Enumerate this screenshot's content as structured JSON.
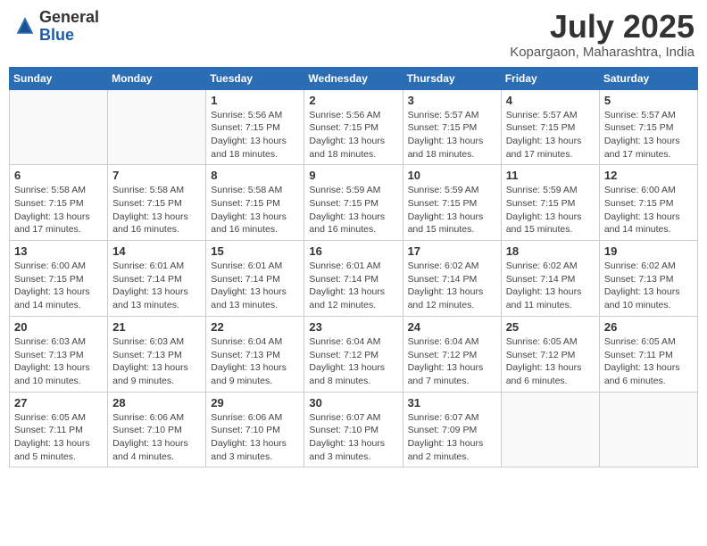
{
  "header": {
    "logo_general": "General",
    "logo_blue": "Blue",
    "title": "July 2025",
    "subtitle": "Kopargaon, Maharashtra, India"
  },
  "days_of_week": [
    "Sunday",
    "Monday",
    "Tuesday",
    "Wednesday",
    "Thursday",
    "Friday",
    "Saturday"
  ],
  "weeks": [
    [
      {
        "day": "",
        "info": ""
      },
      {
        "day": "",
        "info": ""
      },
      {
        "day": "1",
        "info": "Sunrise: 5:56 AM\nSunset: 7:15 PM\nDaylight: 13 hours and 18 minutes."
      },
      {
        "day": "2",
        "info": "Sunrise: 5:56 AM\nSunset: 7:15 PM\nDaylight: 13 hours and 18 minutes."
      },
      {
        "day": "3",
        "info": "Sunrise: 5:57 AM\nSunset: 7:15 PM\nDaylight: 13 hours and 18 minutes."
      },
      {
        "day": "4",
        "info": "Sunrise: 5:57 AM\nSunset: 7:15 PM\nDaylight: 13 hours and 17 minutes."
      },
      {
        "day": "5",
        "info": "Sunrise: 5:57 AM\nSunset: 7:15 PM\nDaylight: 13 hours and 17 minutes."
      }
    ],
    [
      {
        "day": "6",
        "info": "Sunrise: 5:58 AM\nSunset: 7:15 PM\nDaylight: 13 hours and 17 minutes."
      },
      {
        "day": "7",
        "info": "Sunrise: 5:58 AM\nSunset: 7:15 PM\nDaylight: 13 hours and 16 minutes."
      },
      {
        "day": "8",
        "info": "Sunrise: 5:58 AM\nSunset: 7:15 PM\nDaylight: 13 hours and 16 minutes."
      },
      {
        "day": "9",
        "info": "Sunrise: 5:59 AM\nSunset: 7:15 PM\nDaylight: 13 hours and 16 minutes."
      },
      {
        "day": "10",
        "info": "Sunrise: 5:59 AM\nSunset: 7:15 PM\nDaylight: 13 hours and 15 minutes."
      },
      {
        "day": "11",
        "info": "Sunrise: 5:59 AM\nSunset: 7:15 PM\nDaylight: 13 hours and 15 minutes."
      },
      {
        "day": "12",
        "info": "Sunrise: 6:00 AM\nSunset: 7:15 PM\nDaylight: 13 hours and 14 minutes."
      }
    ],
    [
      {
        "day": "13",
        "info": "Sunrise: 6:00 AM\nSunset: 7:15 PM\nDaylight: 13 hours and 14 minutes."
      },
      {
        "day": "14",
        "info": "Sunrise: 6:01 AM\nSunset: 7:14 PM\nDaylight: 13 hours and 13 minutes."
      },
      {
        "day": "15",
        "info": "Sunrise: 6:01 AM\nSunset: 7:14 PM\nDaylight: 13 hours and 13 minutes."
      },
      {
        "day": "16",
        "info": "Sunrise: 6:01 AM\nSunset: 7:14 PM\nDaylight: 13 hours and 12 minutes."
      },
      {
        "day": "17",
        "info": "Sunrise: 6:02 AM\nSunset: 7:14 PM\nDaylight: 13 hours and 12 minutes."
      },
      {
        "day": "18",
        "info": "Sunrise: 6:02 AM\nSunset: 7:14 PM\nDaylight: 13 hours and 11 minutes."
      },
      {
        "day": "19",
        "info": "Sunrise: 6:02 AM\nSunset: 7:13 PM\nDaylight: 13 hours and 10 minutes."
      }
    ],
    [
      {
        "day": "20",
        "info": "Sunrise: 6:03 AM\nSunset: 7:13 PM\nDaylight: 13 hours and 10 minutes."
      },
      {
        "day": "21",
        "info": "Sunrise: 6:03 AM\nSunset: 7:13 PM\nDaylight: 13 hours and 9 minutes."
      },
      {
        "day": "22",
        "info": "Sunrise: 6:04 AM\nSunset: 7:13 PM\nDaylight: 13 hours and 9 minutes."
      },
      {
        "day": "23",
        "info": "Sunrise: 6:04 AM\nSunset: 7:12 PM\nDaylight: 13 hours and 8 minutes."
      },
      {
        "day": "24",
        "info": "Sunrise: 6:04 AM\nSunset: 7:12 PM\nDaylight: 13 hours and 7 minutes."
      },
      {
        "day": "25",
        "info": "Sunrise: 6:05 AM\nSunset: 7:12 PM\nDaylight: 13 hours and 6 minutes."
      },
      {
        "day": "26",
        "info": "Sunrise: 6:05 AM\nSunset: 7:11 PM\nDaylight: 13 hours and 6 minutes."
      }
    ],
    [
      {
        "day": "27",
        "info": "Sunrise: 6:05 AM\nSunset: 7:11 PM\nDaylight: 13 hours and 5 minutes."
      },
      {
        "day": "28",
        "info": "Sunrise: 6:06 AM\nSunset: 7:10 PM\nDaylight: 13 hours and 4 minutes."
      },
      {
        "day": "29",
        "info": "Sunrise: 6:06 AM\nSunset: 7:10 PM\nDaylight: 13 hours and 3 minutes."
      },
      {
        "day": "30",
        "info": "Sunrise: 6:07 AM\nSunset: 7:10 PM\nDaylight: 13 hours and 3 minutes."
      },
      {
        "day": "31",
        "info": "Sunrise: 6:07 AM\nSunset: 7:09 PM\nDaylight: 13 hours and 2 minutes."
      },
      {
        "day": "",
        "info": ""
      },
      {
        "day": "",
        "info": ""
      }
    ]
  ]
}
